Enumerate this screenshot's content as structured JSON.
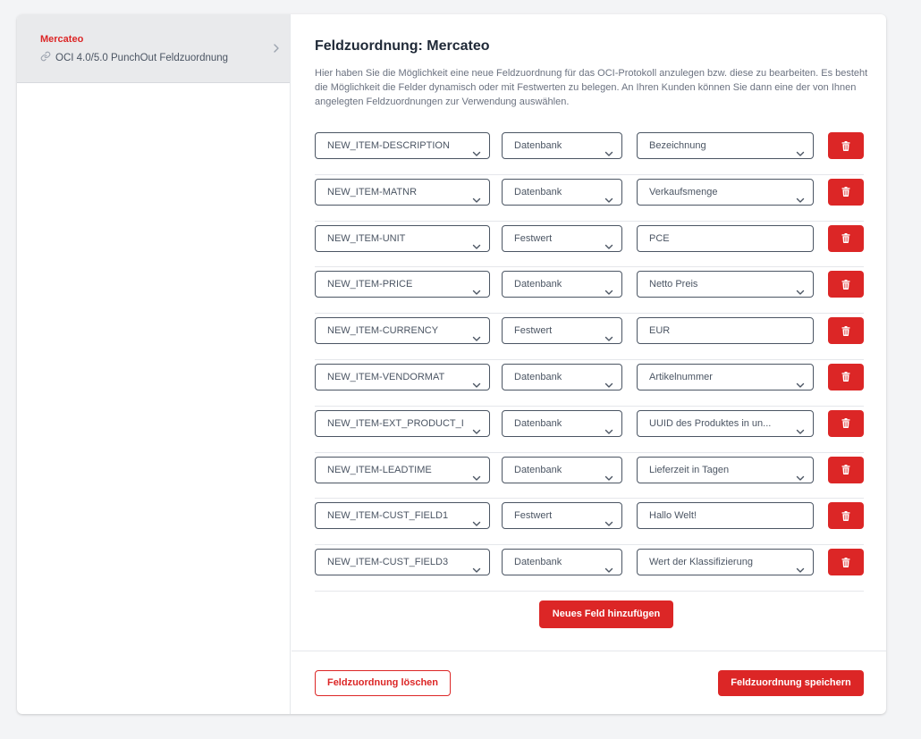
{
  "sidebar": {
    "items": [
      {
        "title": "Mercateo",
        "subtitle": "OCI 4.0/5.0 PunchOut Feldzuordnung",
        "icon": "link-icon"
      }
    ]
  },
  "main": {
    "title": "Feldzuordnung: Mercateo",
    "description": "Hier haben Sie die Möglichkeit eine neue Feldzuordnung für das OCI-Protokoll anzulegen bzw. diese zu bearbeiten. Es besteht die Möglichkeit die Felder dynamisch oder mit Festwerten zu belegen. An Ihren Kunden können Sie dann eine der von Ihnen angelegten Feldzuordnungen zur Verwendung auswählen.",
    "rows": [
      {
        "field": "NEW_ITEM-DESCRIPTION",
        "mode": "Datenbank",
        "value": "Bezeichnung",
        "value_type": "select"
      },
      {
        "field": "NEW_ITEM-MATNR",
        "mode": "Datenbank",
        "value": "Verkaufsmenge",
        "value_type": "select"
      },
      {
        "field": "NEW_ITEM-UNIT",
        "mode": "Festwert",
        "value": "PCE",
        "value_type": "text"
      },
      {
        "field": "NEW_ITEM-PRICE",
        "mode": "Datenbank",
        "value": "Netto Preis",
        "value_type": "select"
      },
      {
        "field": "NEW_ITEM-CURRENCY",
        "mode": "Festwert",
        "value": "EUR",
        "value_type": "text"
      },
      {
        "field": "NEW_ITEM-VENDORMAT",
        "mode": "Datenbank",
        "value": "Artikelnummer",
        "value_type": "select"
      },
      {
        "field": "NEW_ITEM-EXT_PRODUCT_I",
        "mode": "Datenbank",
        "value": "UUID des Produktes in un...",
        "value_type": "select"
      },
      {
        "field": "NEW_ITEM-LEADTIME",
        "mode": "Datenbank",
        "value": "Lieferzeit in Tagen",
        "value_type": "select"
      },
      {
        "field": "NEW_ITEM-CUST_FIELD1",
        "mode": "Festwert",
        "value": "Hallo Welt!",
        "value_type": "text"
      },
      {
        "field": "NEW_ITEM-CUST_FIELD3",
        "mode": "Datenbank",
        "value": "Wert der Klassifizierung",
        "value_type": "select"
      }
    ],
    "add_label": "Neues Feld hinzufügen"
  },
  "footer": {
    "delete_label": "Feldzuordnung löschen",
    "save_label": "Feldzuordnung speichern"
  },
  "colors": {
    "accent": "#dc2626",
    "background": "#f3f4f6",
    "sidebar_active": "#e9eaec"
  }
}
